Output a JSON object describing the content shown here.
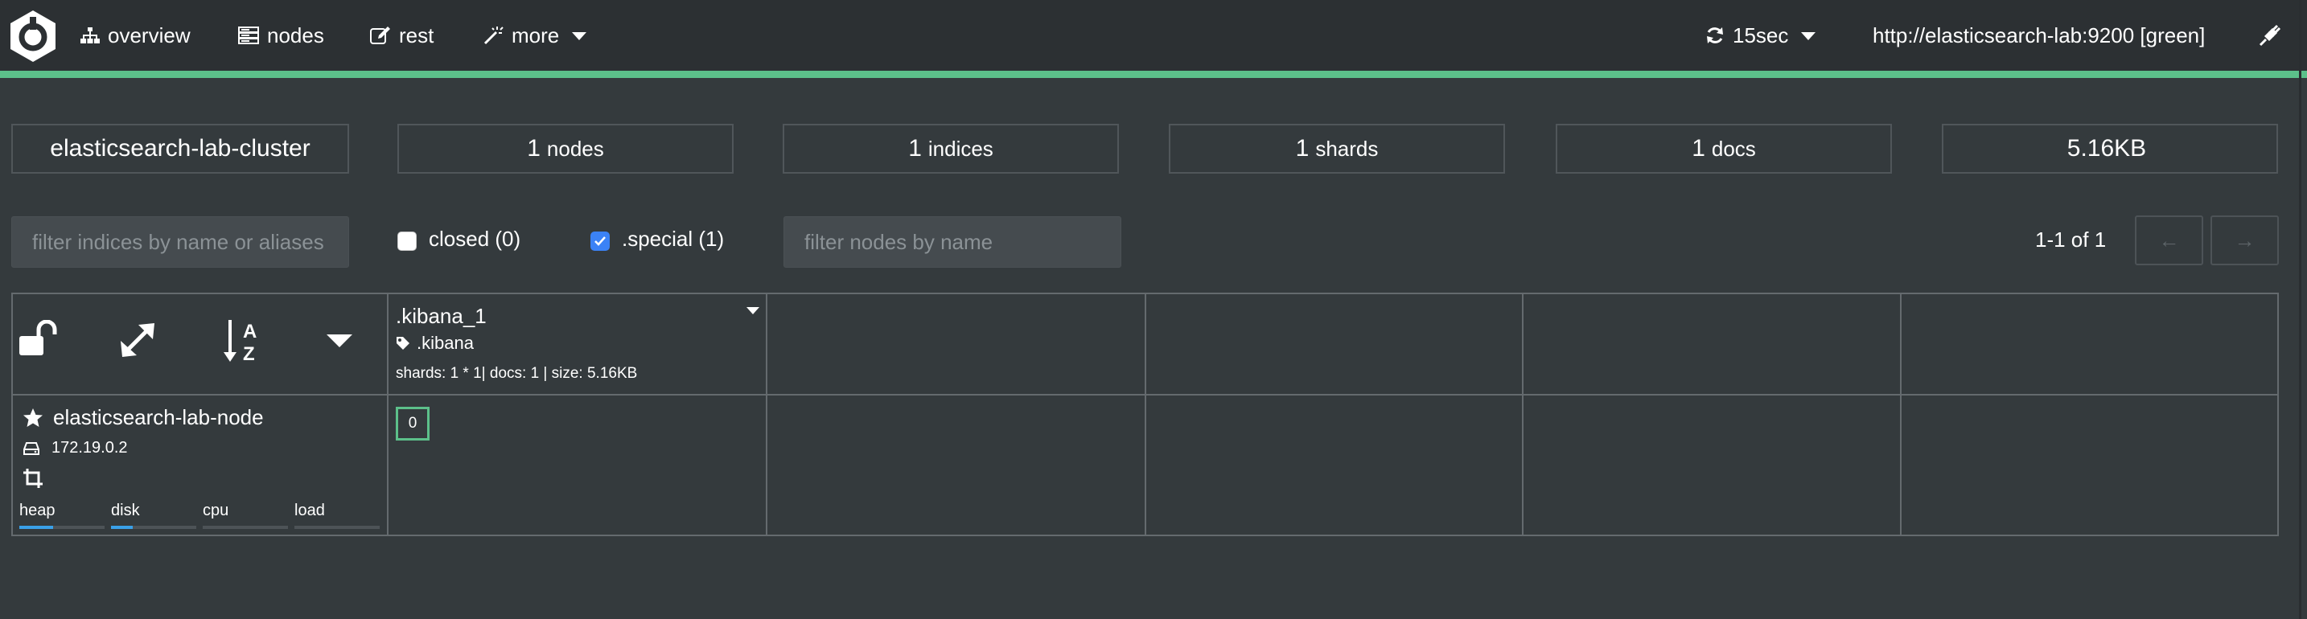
{
  "nav": {
    "items": [
      {
        "label": "overview",
        "icon": "sitemap-icon"
      },
      {
        "label": "nodes",
        "icon": "server-icon"
      },
      {
        "label": "rest",
        "icon": "edit-icon"
      },
      {
        "label": "more",
        "icon": "magic-wand-icon"
      }
    ],
    "refresh_label": "15sec",
    "connection": "http://elasticsearch-lab:9200 [green]",
    "colors": {
      "accent": "#5cc08a",
      "background": "#343a3d",
      "navbar": "#2c3033"
    }
  },
  "stats": {
    "cluster_name": "elasticsearch-lab-cluster",
    "nodes": {
      "value": "1",
      "label": "nodes"
    },
    "indices": {
      "value": "1",
      "label": "indices"
    },
    "shards": {
      "value": "1",
      "label": "shards"
    },
    "docs": {
      "value": "1",
      "label": "docs"
    },
    "size": "5.16KB"
  },
  "filters": {
    "indices_placeholder": "filter indices by name or aliases",
    "closed_label": "closed (0)",
    "closed_checked": false,
    "special_label": ".special (1)",
    "special_checked": true,
    "nodes_placeholder": "filter nodes by name"
  },
  "pagination": {
    "text": "1-1 of 1",
    "prev": "←",
    "next": "→"
  },
  "index": {
    "name": ".kibana_1",
    "alias": ".kibana",
    "meta": "shards: 1 * 1| docs: 1 | size: 5.16KB"
  },
  "node": {
    "name": "elasticsearch-lab-node",
    "ip": "172.19.0.2",
    "metrics": [
      {
        "label": "heap",
        "percent": 40
      },
      {
        "label": "disk",
        "percent": 25
      },
      {
        "label": "cpu",
        "percent": 0
      },
      {
        "label": "load",
        "percent": 0
      }
    ]
  },
  "shard": {
    "number": "0",
    "state_color": "#5cc08a"
  }
}
